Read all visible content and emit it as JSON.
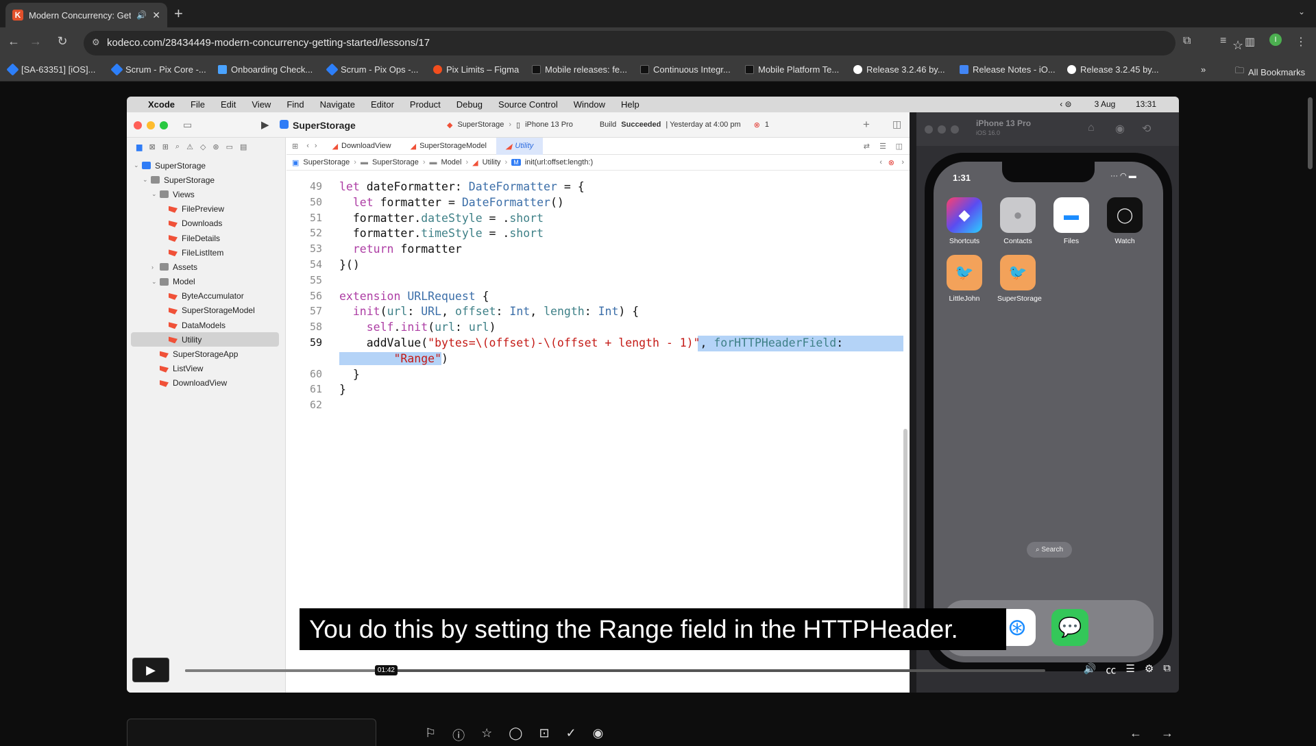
{
  "browser": {
    "tab_title": "Modern Concurrency: Get",
    "tab_favicon": "K",
    "url": "kodeco.com/28434449-modern-concurrency-getting-started/lessons/17",
    "bookmarks": [
      {
        "label": "[SA-63351] [iOS]...",
        "color": "#2d7ff9"
      },
      {
        "label": "Scrum - Pix Core -...",
        "color": "#2d7ff9"
      },
      {
        "label": "Onboarding Check...",
        "color": "#4aa3ff"
      },
      {
        "label": "Scrum - Pix Ops -...",
        "color": "#2d7ff9"
      },
      {
        "label": "Pix Limits – Figma",
        "color": "#f24e1e"
      },
      {
        "label": "Mobile releases: fe...",
        "color": "#111111"
      },
      {
        "label": "Continuous Integr...",
        "color": "#111111"
      },
      {
        "label": "Mobile Platform Te...",
        "color": "#111111"
      },
      {
        "label": "Release 3.2.46 by...",
        "color": "#ffffff"
      },
      {
        "label": "Release Notes - iO...",
        "color": "#4285f4"
      },
      {
        "label": "Release 3.2.45 by...",
        "color": "#ffffff"
      }
    ],
    "all_bookmarks": "All Bookmarks"
  },
  "mac": {
    "menu": [
      "Xcode",
      "File",
      "Edit",
      "View",
      "Find",
      "Navigate",
      "Editor",
      "Product",
      "Debug",
      "Source Control",
      "Window",
      "Help"
    ],
    "date": "3 Aug",
    "time": "13:31"
  },
  "xcode": {
    "project": "SuperStorage",
    "scheme": "SuperStorage",
    "device": "iPhone 13 Pro",
    "build_prefix": "Build",
    "build_status": "Succeeded",
    "build_time": "| Yesterday at 4:00 pm",
    "error_count": "1",
    "tabs": [
      "DownloadView",
      "SuperStorageModel",
      "Utility"
    ],
    "breadcrumb": [
      "SuperStorage",
      "SuperStorage",
      "Model",
      "Utility",
      "init(url:offset:length:)"
    ],
    "tree": [
      {
        "label": "SuperStorage",
        "level": 0,
        "kind": "project",
        "arrow": "open"
      },
      {
        "label": "SuperStorage",
        "level": 1,
        "kind": "folder",
        "arrow": "open"
      },
      {
        "label": "Views",
        "level": 2,
        "kind": "folder",
        "arrow": "open"
      },
      {
        "label": "FilePreview",
        "level": 3,
        "kind": "swift"
      },
      {
        "label": "Downloads",
        "level": 3,
        "kind": "swift"
      },
      {
        "label": "FileDetails",
        "level": 3,
        "kind": "swift"
      },
      {
        "label": "FileListItem",
        "level": 3,
        "kind": "swift"
      },
      {
        "label": "Assets",
        "level": 2,
        "kind": "folder",
        "arrow": "closed"
      },
      {
        "label": "Model",
        "level": 2,
        "kind": "folder",
        "arrow": "open"
      },
      {
        "label": "ByteAccumulator",
        "level": 3,
        "kind": "swift"
      },
      {
        "label": "SuperStorageModel",
        "level": 3,
        "kind": "swift"
      },
      {
        "label": "DataModels",
        "level": 3,
        "kind": "swift"
      },
      {
        "label": "Utility",
        "level": 3,
        "kind": "swift",
        "selected": true
      },
      {
        "label": "SuperStorageApp",
        "level": 2,
        "kind": "swift"
      },
      {
        "label": "ListView",
        "level": 2,
        "kind": "swift"
      },
      {
        "label": "DownloadView",
        "level": 2,
        "kind": "swift"
      }
    ],
    "code": [
      {
        "num": "49",
        "text": "let dateFormatter: DateFormatter = {"
      },
      {
        "num": "50",
        "text": "  let formatter = DateFormatter()"
      },
      {
        "num": "51",
        "text": "  formatter.dateStyle = .short"
      },
      {
        "num": "52",
        "text": "  formatter.timeStyle = .short"
      },
      {
        "num": "53",
        "text": "  return formatter"
      },
      {
        "num": "54",
        "text": "}()"
      },
      {
        "num": "55",
        "text": ""
      },
      {
        "num": "56",
        "text": "extension URLRequest {"
      },
      {
        "num": "57",
        "text": "  init(url: URL, offset: Int, length: Int) {"
      },
      {
        "num": "58",
        "text": "    self.init(url: url)"
      },
      {
        "num": "59",
        "text": "    addValue(\"bytes=\\(offset)-\\(offset + length - 1)\", forHTTPHeaderField:"
      },
      {
        "num": "",
        "text": "        \"Range\")"
      },
      {
        "num": "60",
        "text": "  }"
      },
      {
        "num": "61",
        "text": "}"
      },
      {
        "num": "62",
        "text": ""
      }
    ]
  },
  "simulator": {
    "device": "iPhone 13 Pro",
    "os": "iOS 16.0",
    "time": "1:31",
    "apps": [
      {
        "label": "Shortcuts",
        "color": "#6a4df2",
        "icon": "shortcuts-icon"
      },
      {
        "label": "Contacts",
        "color": "#c9c9cc",
        "icon": "contacts-icon"
      },
      {
        "label": "Files",
        "color": "#ffffff",
        "icon": "files-icon"
      },
      {
        "label": "Watch",
        "color": "#111111",
        "icon": "watch-icon"
      },
      {
        "label": "LittleJohn",
        "color": "#f3a25a",
        "icon": "littlejohn-icon"
      },
      {
        "label": "SuperStorage",
        "color": "#f3a25a",
        "icon": "superstorage-icon"
      }
    ],
    "search": "Search"
  },
  "video": {
    "caption": "You do this by setting the Range field in the HTTPHeader.",
    "time": "01:42",
    "progress": 0.235
  }
}
